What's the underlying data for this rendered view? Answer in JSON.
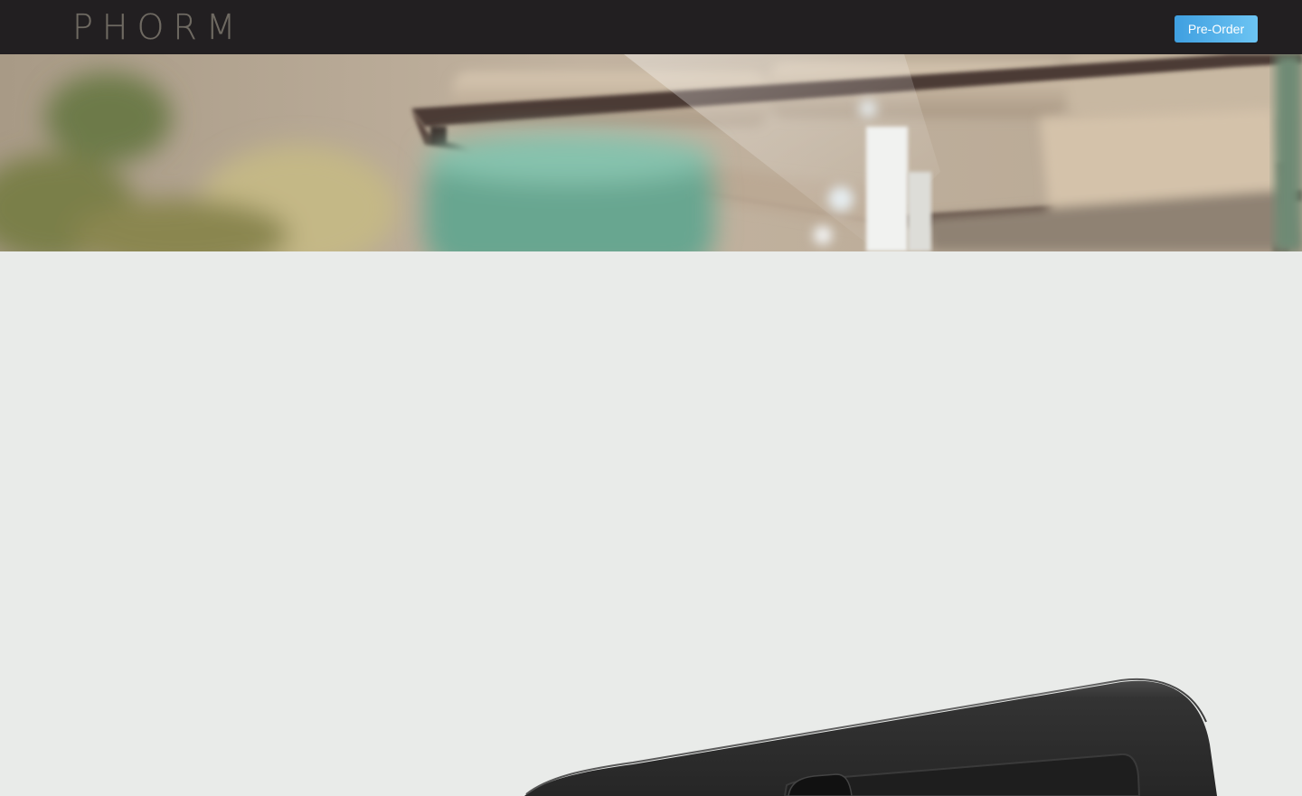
{
  "header": {
    "logo_text": "PHORM",
    "preorder_label": "Pre-Order"
  },
  "colors": {
    "topbar": "#221f21",
    "button_gradient_start": "#3f9fe0",
    "button_gradient_end": "#6cc4f3",
    "page_background": "#e9ebe9",
    "device_body": "#2b2b2b"
  },
  "hero": {
    "image_subject": "blurred-outdoor-lounge-photo"
  },
  "product": {
    "image_subject": "dark-phone-case-device"
  }
}
